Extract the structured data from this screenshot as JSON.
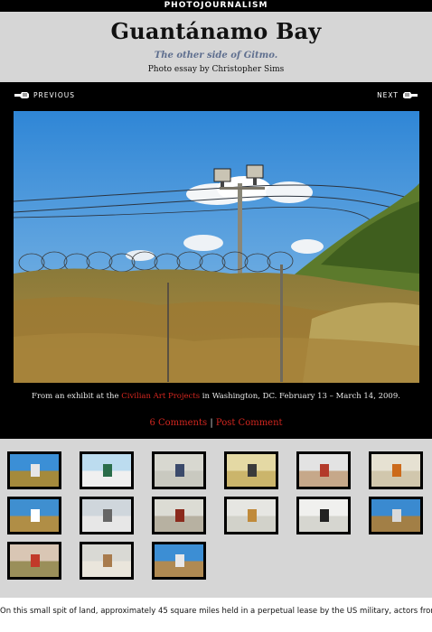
{
  "section_label": "PHOTOJOURNALISM",
  "header": {
    "title": "Guantánamo Bay",
    "subtitle": "The other side of Gitmo.",
    "byline": "Photo essay by Christopher Sims"
  },
  "nav": {
    "previous_label": "PREVIOUS",
    "next_label": "NEXT"
  },
  "caption": {
    "prefix": "From an exhibit at the ",
    "link": "Civilian Art Projects",
    "suffix": " in Washington, DC. February 13 – March 14, 2009."
  },
  "comments": {
    "count_label": "6 Comments",
    "separator": "|",
    "post_label": "Post Comment"
  },
  "thumbnails": [
    {
      "id": "thumb-1",
      "sky": "#3b8fd6",
      "ground": "#a58a3c",
      "accent": "#e6e6e6"
    },
    {
      "id": "thumb-2",
      "sky": "#bcdcef",
      "ground": "#f0f0f0",
      "accent": "#2a6d4a"
    },
    {
      "id": "thumb-3",
      "sky": "#d8d8d0",
      "ground": "#c9c9c0",
      "accent": "#3b4a6b"
    },
    {
      "id": "thumb-4",
      "sky": "#e4d9a4",
      "ground": "#cbb56b",
      "accent": "#3a3a3a"
    },
    {
      "id": "thumb-5",
      "sky": "#e3e3e3",
      "ground": "#c6a88a",
      "accent": "#b33a2a"
    },
    {
      "id": "thumb-6",
      "sky": "#e6e1d2",
      "ground": "#d1c7ad",
      "accent": "#cc6a1a"
    },
    {
      "id": "thumb-7",
      "sky": "#3f8fd0",
      "ground": "#b08e46",
      "accent": "#ffffff"
    },
    {
      "id": "thumb-8",
      "sky": "#cfd6dc",
      "ground": "#e7e7e7",
      "accent": "#666666"
    },
    {
      "id": "thumb-9",
      "sky": "#dcdcd4",
      "ground": "#b7b1a1",
      "accent": "#8b2a1c"
    },
    {
      "id": "thumb-10",
      "sky": "#e6e6e2",
      "ground": "#d2d2ca",
      "accent": "#c08a3a"
    },
    {
      "id": "thumb-11",
      "sky": "#f0f0ee",
      "ground": "#d6d6d0",
      "accent": "#222222"
    },
    {
      "id": "thumb-12",
      "sky": "#3a8ad0",
      "ground": "#a27f46",
      "accent": "#d9d9d9"
    },
    {
      "id": "thumb-13",
      "sky": "#d9c6b4",
      "ground": "#9a8f5a",
      "accent": "#c23a2a"
    },
    {
      "id": "thumb-14",
      "sky": "#d9d9d4",
      "ground": "#eae6dc",
      "accent": "#a87b4c"
    },
    {
      "id": "thumb-15",
      "sky": "#3c8ed4",
      "ground": "#b08a52",
      "accent": "#e8e8e8"
    }
  ],
  "body_text": "On this small spit of land, approximately 45 square miles held in a perpetual lease by the US military, actors from the world stage converge: American interrogators attempt to wrest information from Muslim"
}
